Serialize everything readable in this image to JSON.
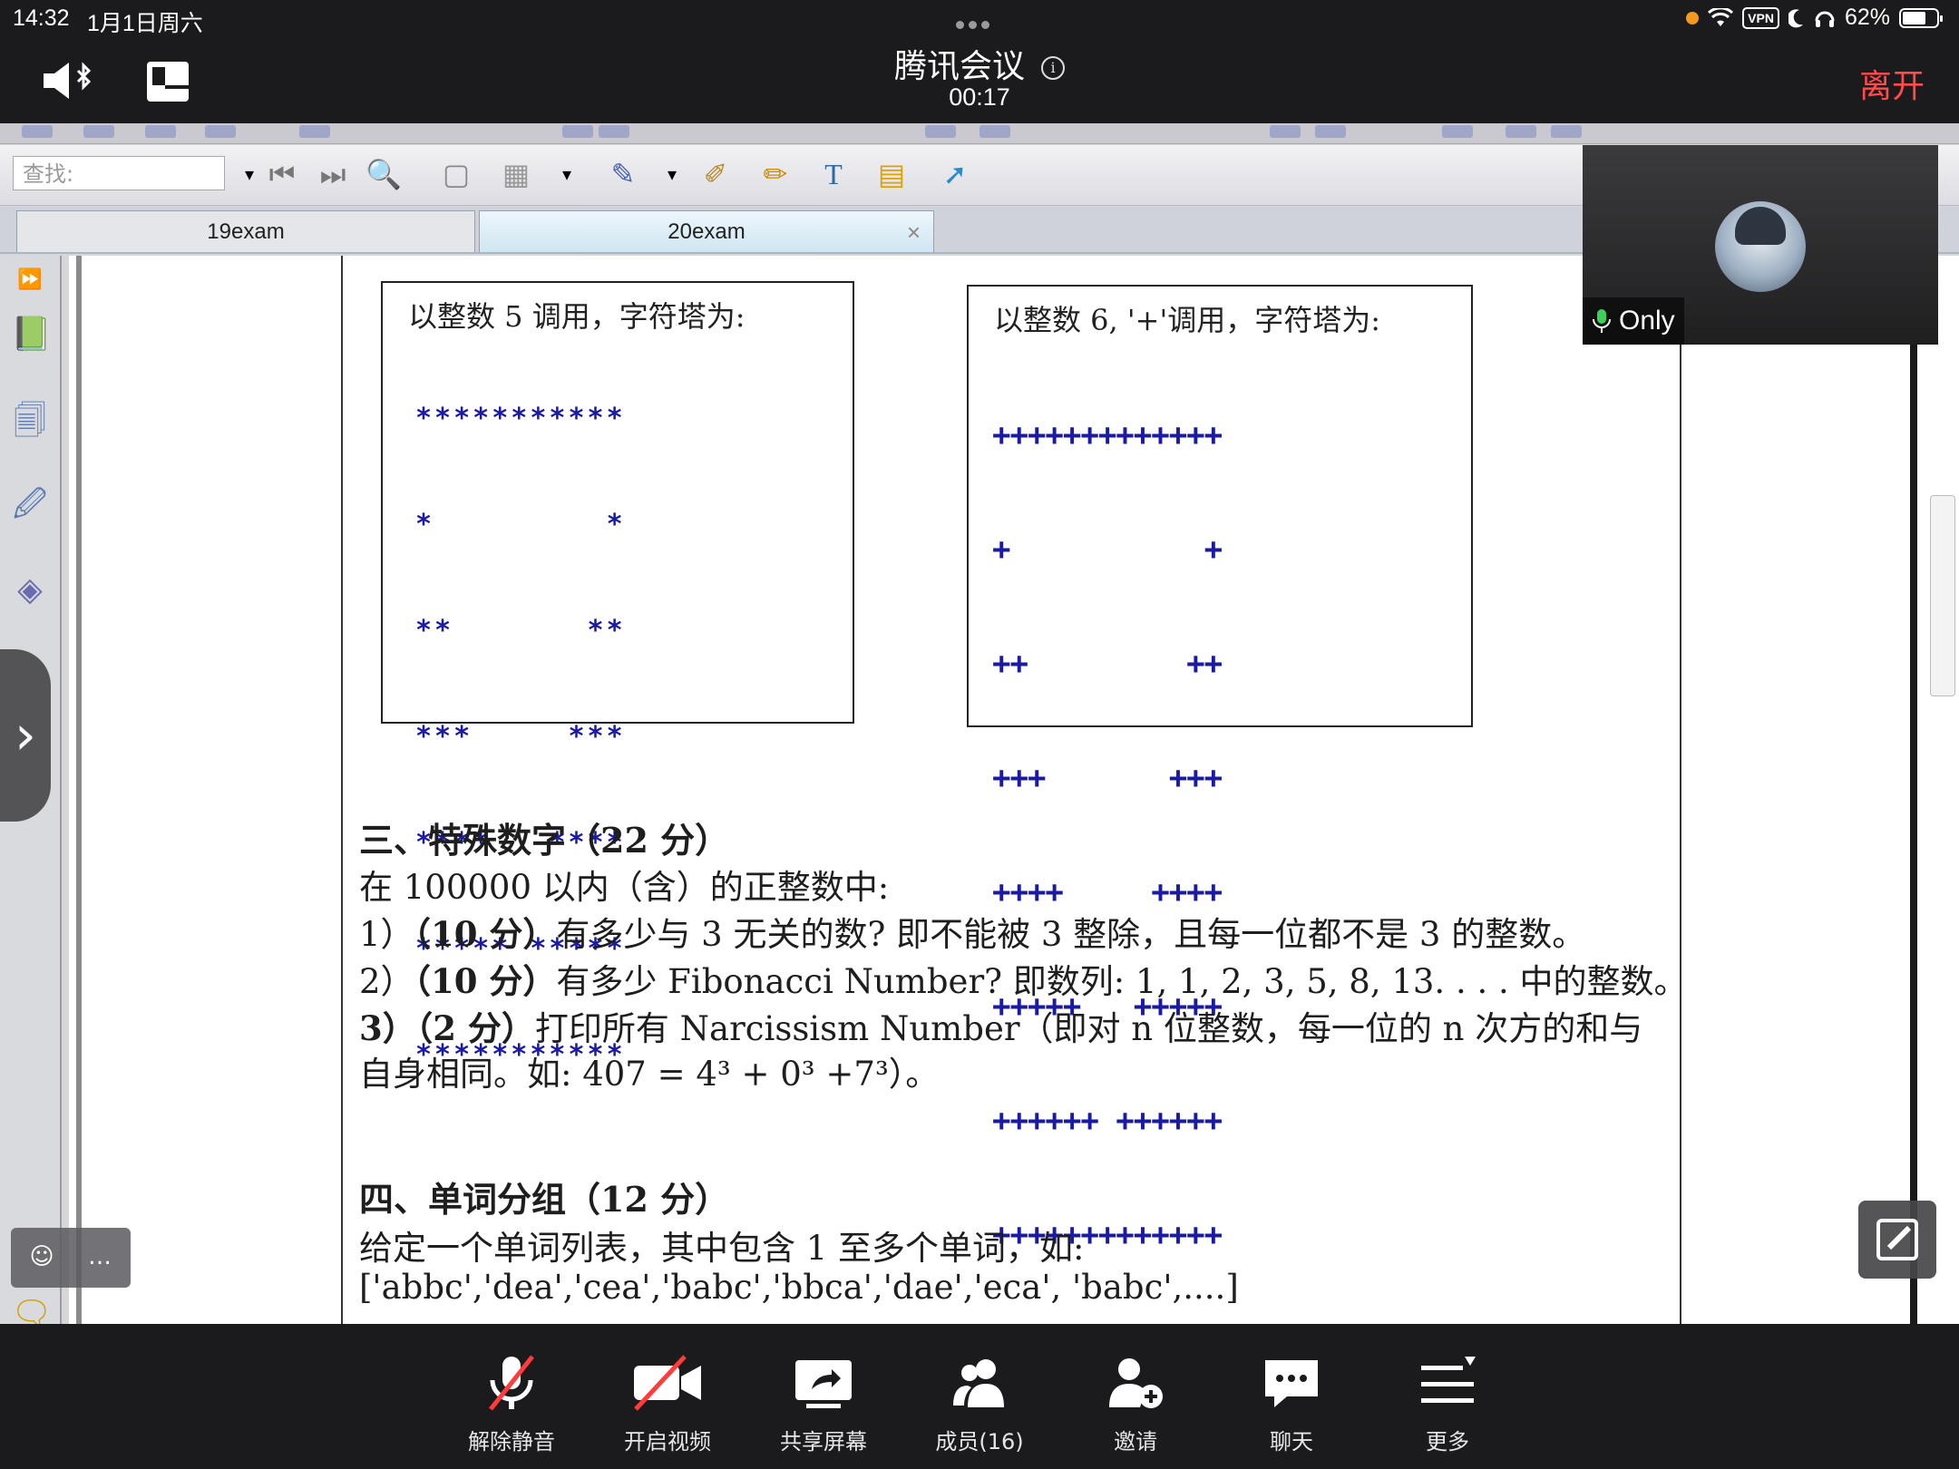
{
  "status_bar": {
    "time": "14:32",
    "date": "1月1日周六",
    "vpn_label": "VPN",
    "battery": "62%"
  },
  "meeting": {
    "title": "腾讯会议",
    "timer": "00:17",
    "leave_label": "离开"
  },
  "viewer": {
    "search_placeholder": "查找:",
    "tabs": [
      {
        "label": "19exam"
      },
      {
        "label": "20exam",
        "close": "×"
      }
    ]
  },
  "document": {
    "box1_caption": "以整数 5 调用，字符塔为:",
    "box1_rows": [
      "***********",
      "*         *",
      "**       **",
      "***     ***",
      "****   ****",
      "***** *****",
      "***********"
    ],
    "box2_caption": "以整数 6, '+'调用，字符塔为:",
    "box2_rows": [
      "+++++++++++++",
      "+           +",
      "++         ++",
      "+++       +++",
      "++++     ++++",
      "+++++   +++++",
      "++++++ ++++++",
      "+++++++++++++"
    ],
    "section3_title": "三、特殊数字（22 分）",
    "section3_intro": "在 100000 以内（含）的正整数中:",
    "q1_prefix": "1）",
    "q1_points": "（10 分）",
    "q1_text": "有多少与 3 无关的数? 即不能被 3 整除，且每一位都不是 3 的整数。",
    "q2_prefix": "2）",
    "q2_points": "（10 分）",
    "q2_text": "有多少 Fibonacci Number? 即数列: 1, 1, 2, 3, 5, 8, 13. . . . 中的整数。",
    "q3_prefix": "3）",
    "q3_points": "（2 分）",
    "q3_text": "打印所有 Narcissism Number（即对 n 位整数，每一位的 n 次方的和与",
    "q3_text2": "自身相同。如: 407 = 4³ + 0³ +7³）。",
    "section4_title": "四、单词分组（12 分）",
    "section4_intro": "给定一个单词列表，其中包含 1 至多个单词，如:",
    "section4_example": "['abbc','dea','cea','babc','bbca','dae','eca', 'babc',....]"
  },
  "self_video": {
    "name": "Only"
  },
  "bottom_bar": {
    "items": [
      {
        "label": "解除静音"
      },
      {
        "label": "开启视频"
      },
      {
        "label": "共享屏幕"
      },
      {
        "label": "成员(16)"
      },
      {
        "label": "邀请"
      },
      {
        "label": "聊天"
      },
      {
        "label": "更多"
      }
    ]
  },
  "colors": {
    "leave": "#ff4b4b",
    "pattern": "#1a1aa6",
    "bar_bg": "#1b1b1d"
  }
}
